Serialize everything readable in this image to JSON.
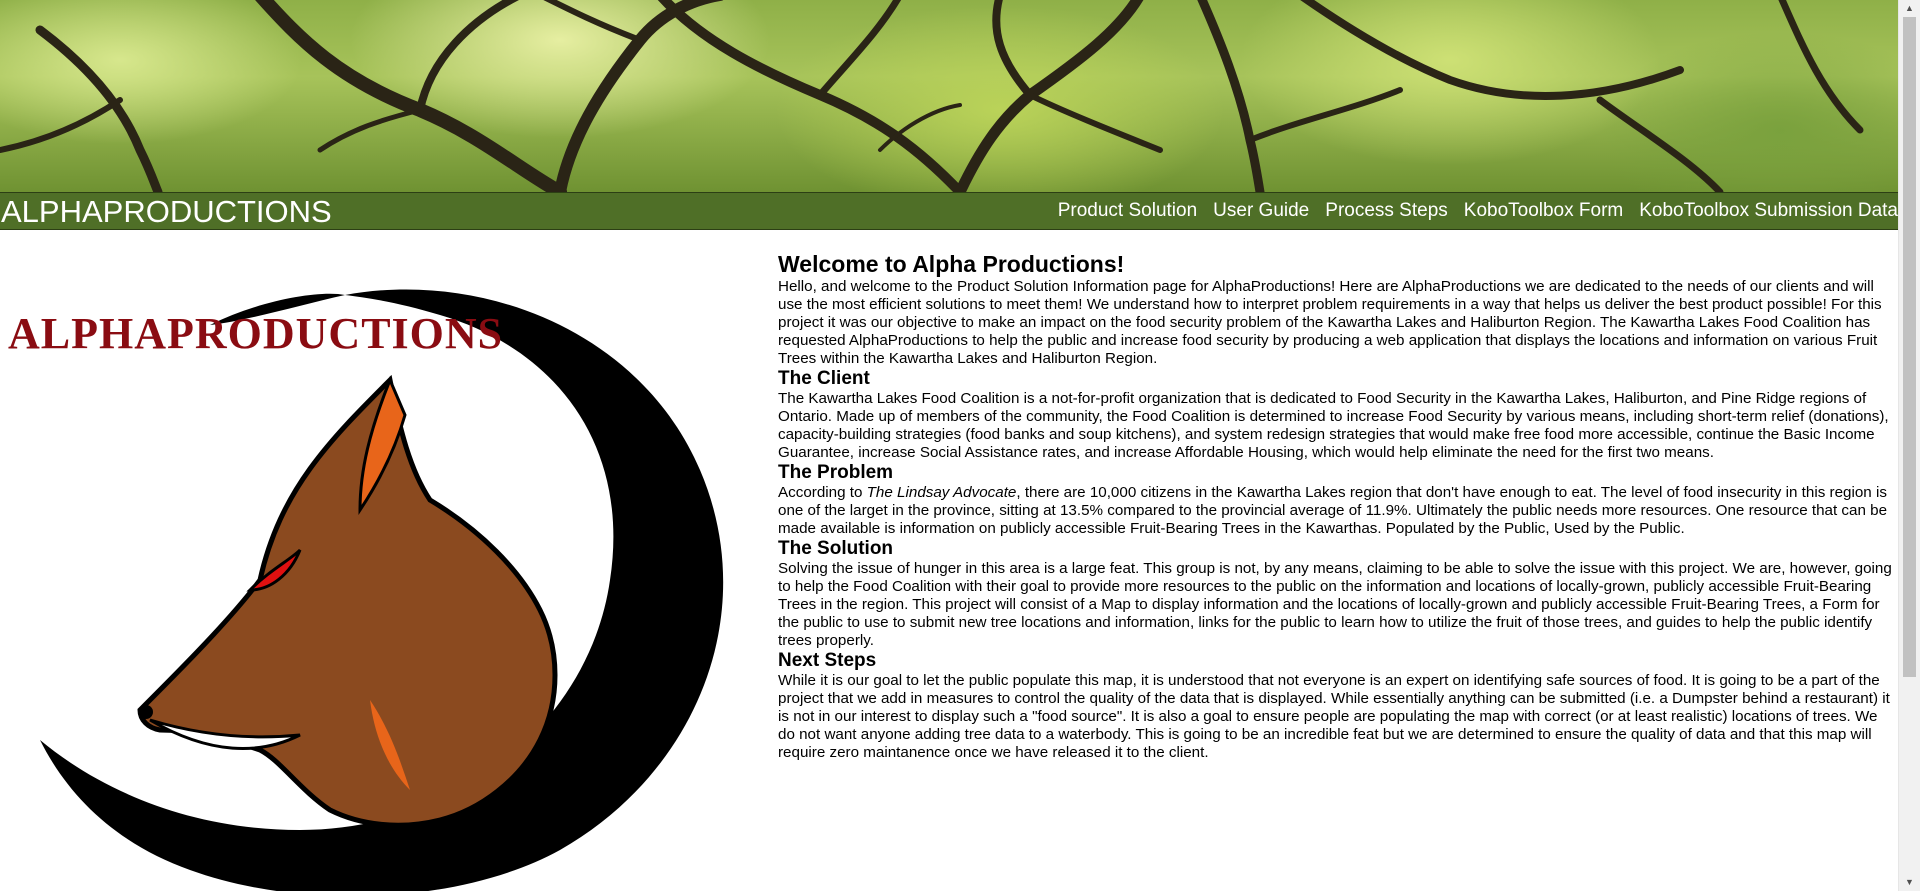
{
  "header": {
    "brand": "ALPHAPRODUCTIONS",
    "nav": [
      "Product Solution",
      "User Guide",
      "Process Steps",
      "KoboToolbox Form",
      "KoboToolbox Submission Data"
    ]
  },
  "logo": {
    "text": "ALPHAPRODUCTIONS",
    "colors": {
      "wordmark": "#8a0c12",
      "fox": "#8b4a1f",
      "fox_accent": "#e8651a",
      "eye": "#e01010",
      "swirl": "#000000"
    }
  },
  "main": {
    "title": "Welcome to Alpha Productions!",
    "intro": "Hello, and welcome to the Product Solution Information page for AlphaProductions! Here are AlphaProductions we are dedicated to the needs of our clients and will use the most efficient solutions to meet them! We understand how to interpret problem requirements in a way that helps us deliver the best product possible! For this project it was our objective to make an impact on the food security problem of the Kawartha Lakes and Haliburton Region. The Kawartha Lakes Food Coalition has requested AlphaProductions to help the public and increase food security by producing a web application that displays the locations and information on various Fruit Trees within the Kawartha Lakes and Haliburton Region.",
    "sections": {
      "client": {
        "heading": "The Client",
        "text": "The Kawartha Lakes Food Coalition is a not-for-profit organization that is dedicated to Food Security in the Kawartha Lakes, Haliburton, and Pine Ridge regions of Ontario. Made up of members of the community, the Food Coalition is determined to increase Food Security by various means, including short-term relief (donations), capacity-building strategies (food banks and soup kitchens), and system redesign strategies that would make free food more accessible, continue the Basic Income Guarantee, increase Social Assistance rates, and increase Affordable Housing, which would help eliminate the need for the first two means."
      },
      "problem": {
        "heading": "The Problem",
        "prefix": "According to ",
        "source": "The Lindsay Advocate",
        "text": ", there are 10,000 citizens in the Kawartha Lakes region that don't have enough to eat. The level of food insecurity in this region is one of the larget in the province, sitting at 13.5% compared to the provincial average of 11.9%. Ultimately the public needs more resources. One resource that can be made available is information on publicly accessible Fruit-Bearing Trees in the Kawarthas. Populated by the Public, Used by the Public."
      },
      "solution": {
        "heading": "The Solution",
        "text": "Solving the issue of hunger in this area is a large feat. This group is not, by any means, claiming to be able to solve the issue with this project. We are, however, going to help the Food Coalition with their goal to provide more resources to the public on the information and locations of locally-grown, publicly accessible Fruit-Bearing Trees in the region. This project will consist of a Map to display information and the locations of locally-grown and publicly accessible Fruit-Bearing Trees, a Form for the public to use to submit new tree locations and information, links for the public to learn how to utilize the fruit of those trees, and guides to help the public identify trees properly."
      },
      "next": {
        "heading": "Next Steps",
        "text": "While it is our goal to let the public populate this map, it is understood that not everyone is an expert on identifying safe sources of food. It is going to be a part of the project that we add in measures to control the quality of the data that is displayed. While essentially anything can be submitted (i.e. a Dumpster behind a restaurant) it is not in our interest to display such a \"food source\". It is also a goal to ensure people are populating the map with correct (or at least realistic) locations of trees. We do not want anyone adding tree data to a waterbody. This is going to be an incredible feat but we are determined to ensure the quality of data and that this map will require zero maintanence once we have released it to the client."
      }
    }
  },
  "colors": {
    "navbar": "#4f6f27",
    "nav_text": "#ffffff"
  }
}
